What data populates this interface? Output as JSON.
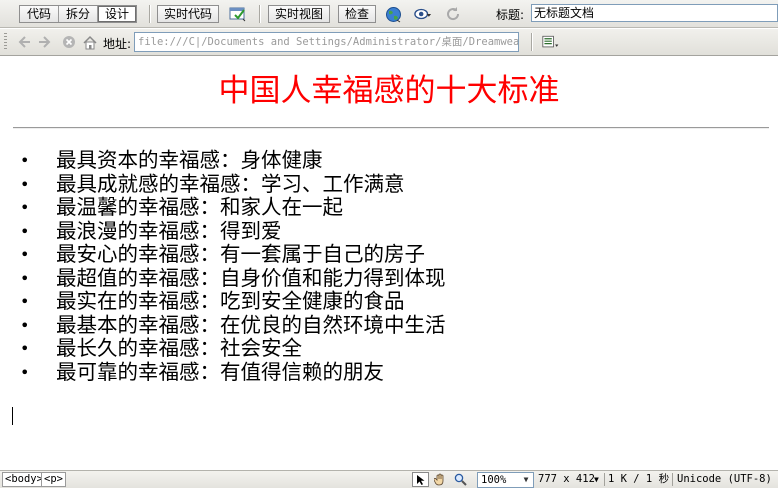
{
  "toolbar": {
    "view_modes": [
      "代码",
      "拆分",
      "设计"
    ],
    "active_view": "设计",
    "live_code_label": "实时代码",
    "live_view_label": "实时视图",
    "inspect_label": "检查",
    "title_label": "标题:",
    "title_value": "无标题文档"
  },
  "nav": {
    "address_label": "地址:",
    "address_value": "file:///C|/Documents and Settings/Administrator/桌面/Dreamweaver"
  },
  "document": {
    "heading": "中国人幸福感的十大标准",
    "heading_color": "#ff0000",
    "bullet": "•",
    "items": [
      "最具资本的幸福感：身体健康",
      "最具成就感的幸福感：学习、工作满意",
      "最温馨的幸福感：和家人在一起",
      "最浪漫的幸福感：得到爱",
      "最安心的幸福感：有一套属于自己的房子",
      "最超值的幸福感：自身价值和能力得到体现",
      "最实在的幸福感：吃到安全健康的食品",
      "最基本的幸福感：在优良的自然环境中生活",
      "最长久的幸福感：社会安全",
      "最可靠的幸福感：有值得信赖的朋友"
    ]
  },
  "status": {
    "tags": [
      "<body>",
      "<p>"
    ],
    "zoom": "100%",
    "window_size": "777 x 412",
    "file_info": "1 K / 1 秒",
    "encoding": "Unicode (UTF-8)"
  }
}
